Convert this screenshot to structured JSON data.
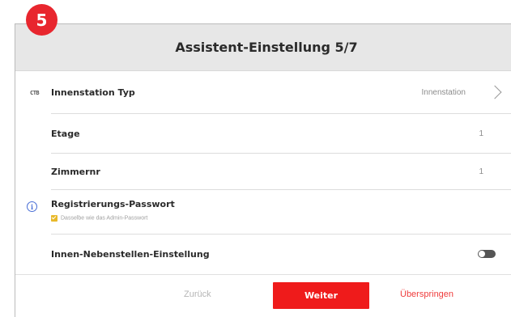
{
  "step_badge": "5",
  "header": {
    "title": "Assistent-Einstellung 5/7"
  },
  "rows": {
    "station_type": {
      "icon_text": "ϹΤΒ",
      "label": "Innenstation Typ",
      "value": "Innenstation"
    },
    "floor": {
      "label": "Etage",
      "value": "1"
    },
    "room": {
      "label": "Zimmernr",
      "value": "1"
    },
    "password": {
      "label": "Registrierungs-Passwort",
      "checkbox_text": "Dasselbe wie das Admin-Passwort",
      "checked": true
    },
    "extension": {
      "label": "Innen-Nebenstellen-Einstellung",
      "toggle_on": false
    }
  },
  "footer": {
    "back_label": "Zurück",
    "next_label": "Weiter",
    "skip_label": "Überspringen"
  },
  "colors": {
    "accent": "#ef1b1b",
    "badge": "#e8262e",
    "header_bg": "#e7e7e7",
    "checkbox": "#e8b92a",
    "info": "#4a6fd6"
  }
}
